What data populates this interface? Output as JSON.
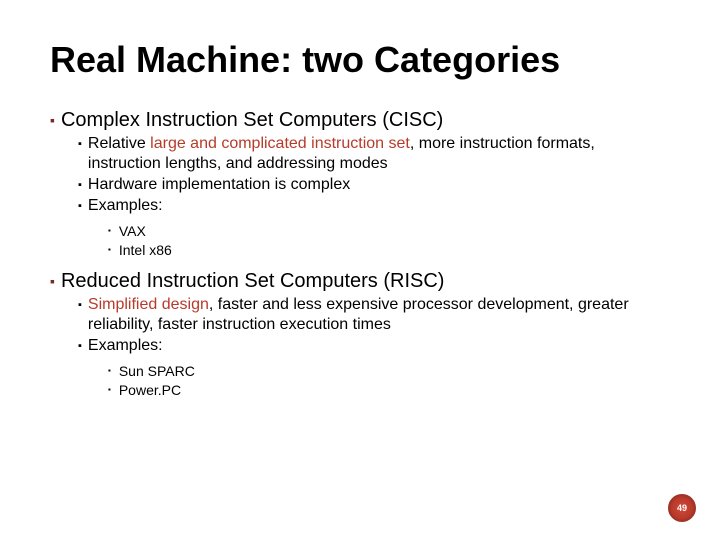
{
  "title": "Real Machine: two Categories",
  "sections": [
    {
      "heading": "Complex Instruction Set Computers (CISC)",
      "points": [
        {
          "pre": "Relative ",
          "accent": "large and complicated instruction set",
          "post": ", more instruction formats, instruction lengths, and addressing modes"
        },
        {
          "pre": "Hardware implementation is complex",
          "accent": "",
          "post": ""
        },
        {
          "pre": "Examples:",
          "accent": "",
          "post": ""
        }
      ],
      "examples": [
        "VAX",
        "Intel x86"
      ]
    },
    {
      "heading": "Reduced Instruction Set Computers (RISC)",
      "points": [
        {
          "pre": "",
          "accent": "Simplified design",
          "post": ", faster and less expensive processor development, greater reliability, faster instruction execution times"
        },
        {
          "pre": "Examples:",
          "accent": "",
          "post": ""
        }
      ],
      "examples": [
        "Sun SPARC",
        "Power.PC"
      ]
    }
  ],
  "page": "49"
}
